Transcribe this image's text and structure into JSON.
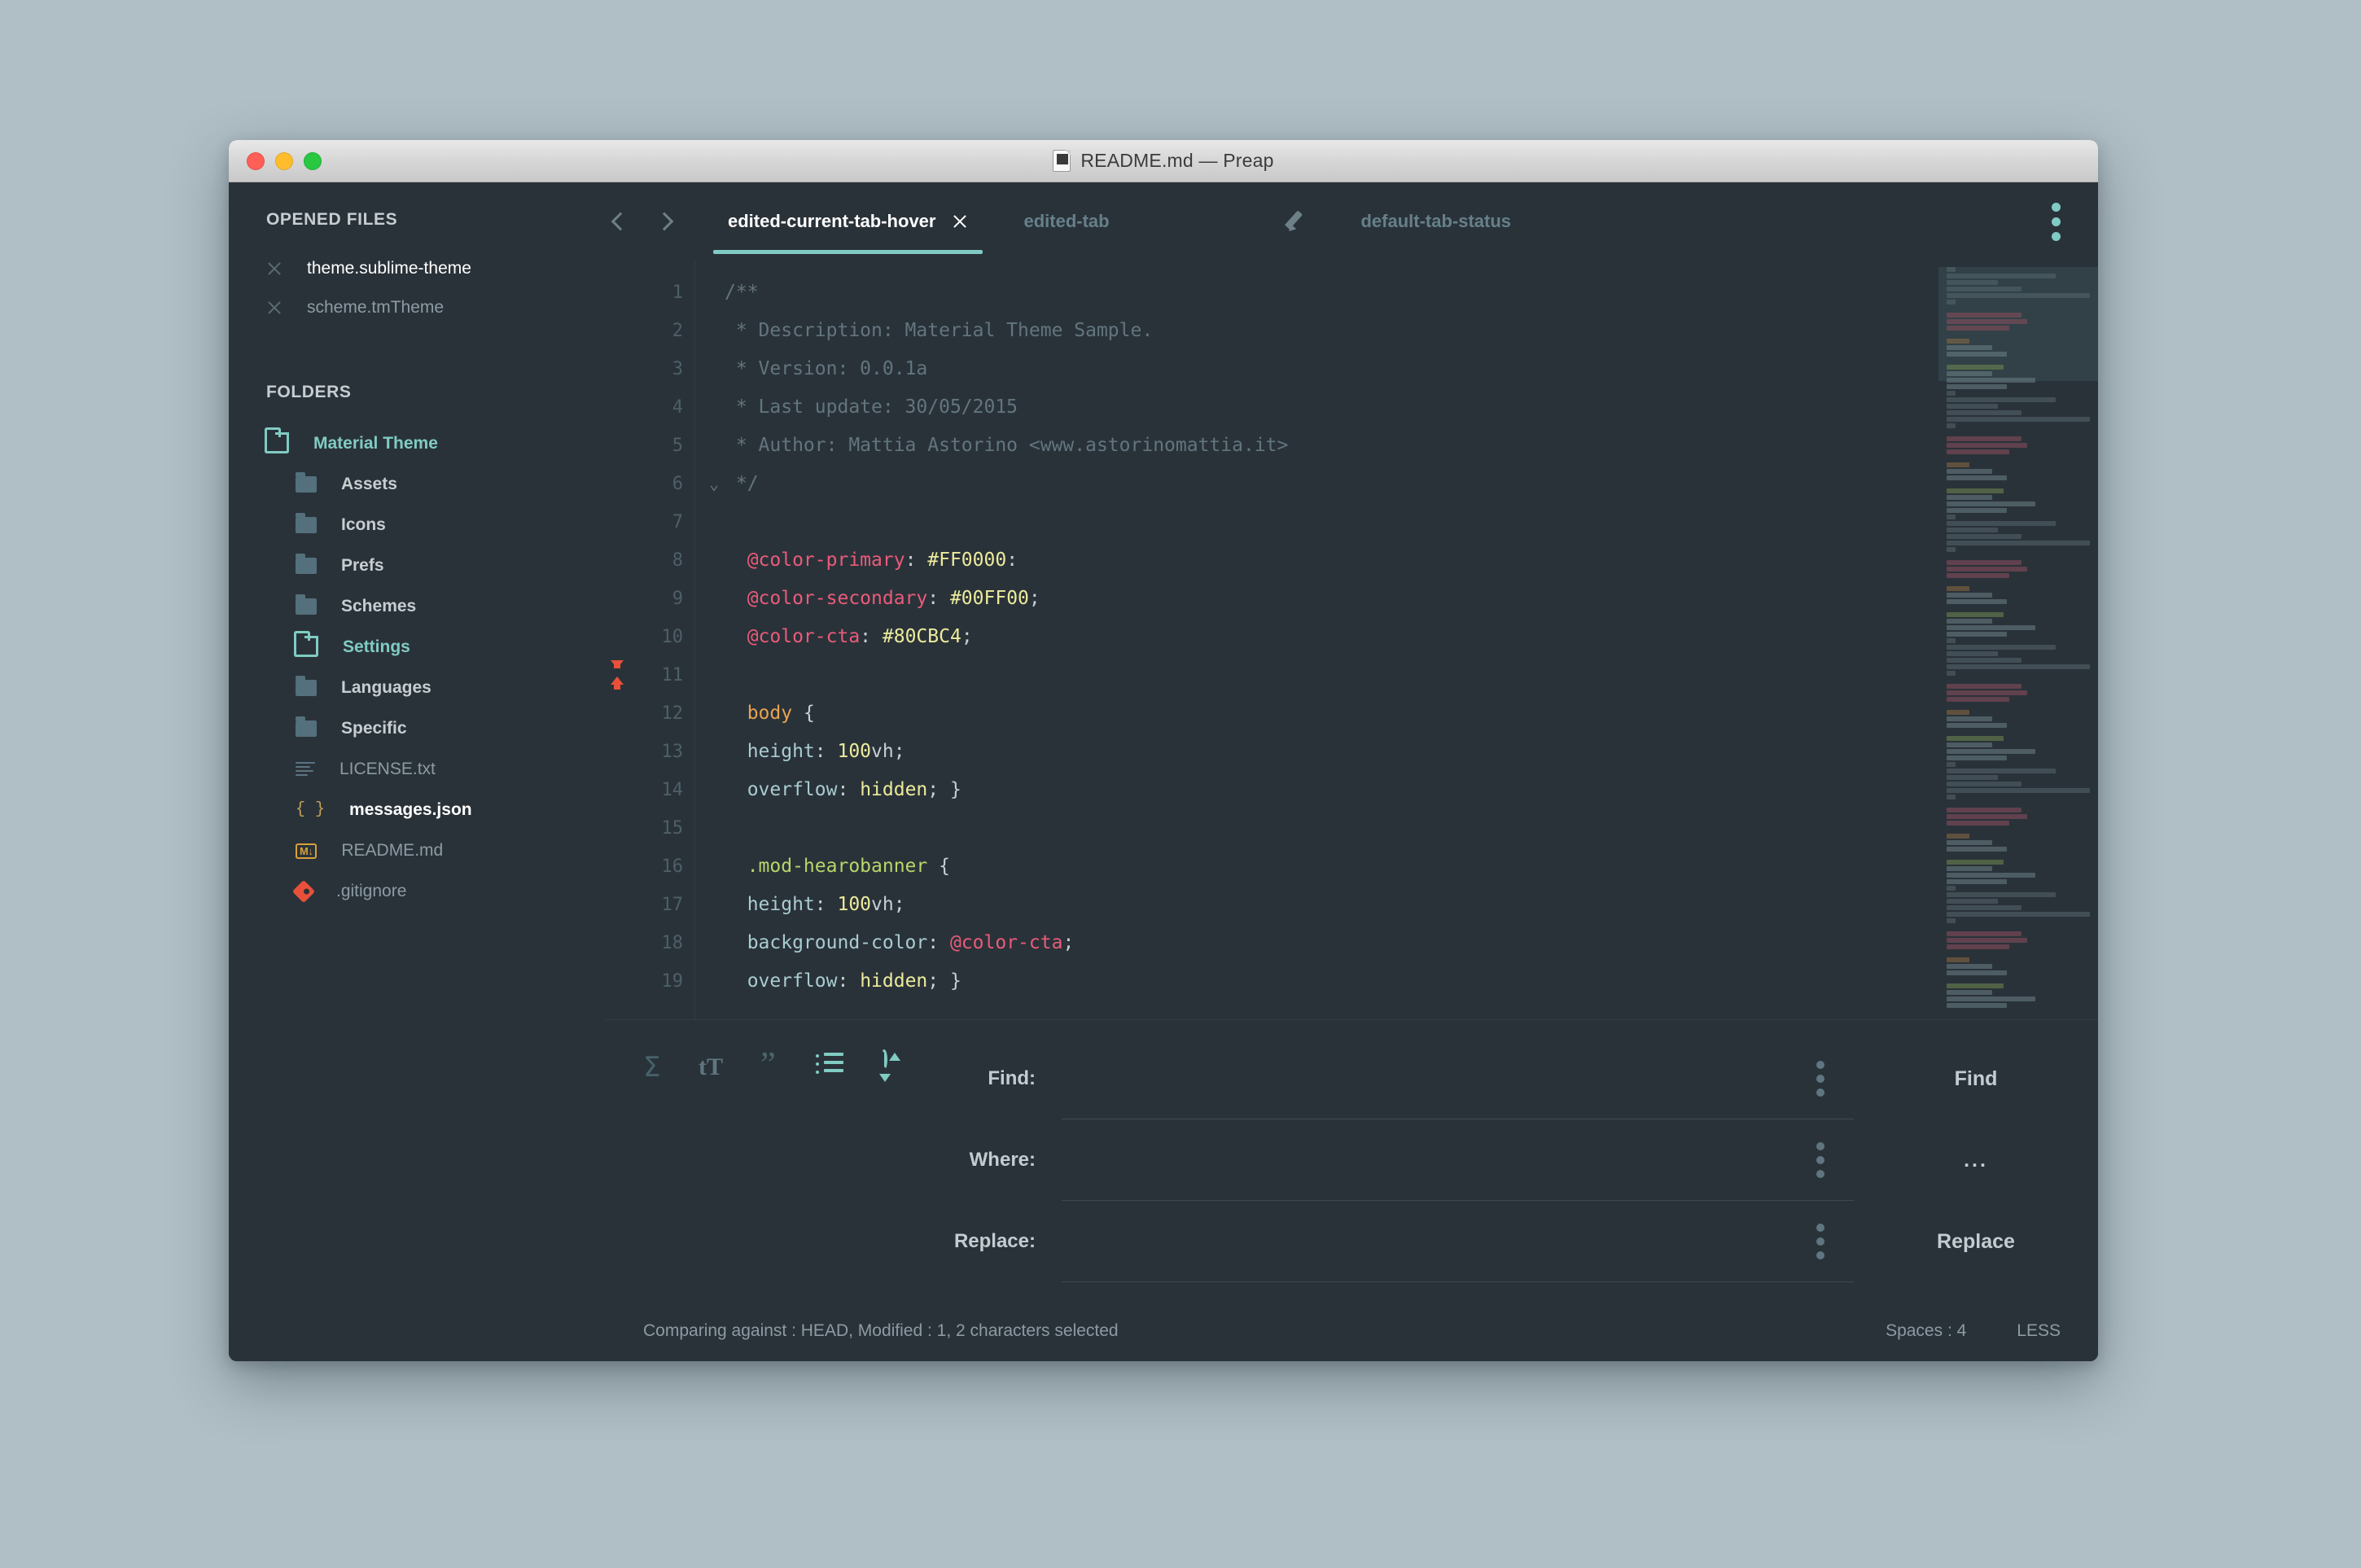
{
  "window": {
    "title": "README.md — Preap",
    "doc_icon": "markdown-file-icon",
    "traffic": {
      "close": "close-button",
      "minimize": "minimize-button",
      "zoom": "zoom-button"
    }
  },
  "sidebar": {
    "opened_files_header": "OPENED FILES",
    "opened_files": [
      {
        "name": "theme.sublime-theme",
        "active": true
      },
      {
        "name": "scheme.tmTheme",
        "active": false
      }
    ],
    "folders_header": "FOLDERS",
    "tree": [
      {
        "label": "Material Theme",
        "icon": "folder-open-icon",
        "kind": "root",
        "depth": 0
      },
      {
        "label": "Assets",
        "icon": "folder-icon",
        "kind": "folder",
        "depth": 1
      },
      {
        "label": "Icons",
        "icon": "folder-icon",
        "kind": "folder",
        "depth": 1
      },
      {
        "label": "Prefs",
        "icon": "folder-icon",
        "kind": "folder",
        "depth": 1
      },
      {
        "label": "Schemes",
        "icon": "folder-icon",
        "kind": "folder",
        "depth": 1
      },
      {
        "label": "Settings",
        "icon": "folder-open-icon",
        "kind": "folder-open",
        "depth": 1
      },
      {
        "label": "Languages",
        "icon": "folder-icon",
        "kind": "folder",
        "depth": 1
      },
      {
        "label": "Specific",
        "icon": "folder-icon",
        "kind": "folder",
        "depth": 1
      },
      {
        "label": "LICENSE.txt",
        "icon": "text-file-icon",
        "kind": "file",
        "depth": 1
      },
      {
        "label": "messages.json",
        "icon": "json-file-icon",
        "kind": "file-active",
        "depth": 1
      },
      {
        "label": "README.md",
        "icon": "markdown-file-icon",
        "kind": "file",
        "depth": 1
      },
      {
        "label": ".gitignore",
        "icon": "git-file-icon",
        "kind": "file",
        "depth": 1
      }
    ]
  },
  "tabs": {
    "prev_icon": "chevron-left-icon",
    "next_icon": "chevron-right-icon",
    "menu_icon": "overflow-menu-icon",
    "items": [
      {
        "label": "edited-current-tab-hover",
        "state": "active",
        "close_icon": "close-icon"
      },
      {
        "label": "edited-tab",
        "state": "edited",
        "close_icon": "pencil-icon"
      },
      {
        "label": "default-tab-status",
        "state": "default",
        "close_icon": ""
      }
    ]
  },
  "editor": {
    "language": "LESS",
    "lines": [
      {
        "n": "1",
        "fold": "",
        "mark": "",
        "tokens": [
          {
            "t": "/**",
            "c": "c-comment"
          }
        ]
      },
      {
        "n": "2",
        "fold": "",
        "mark": "",
        "tokens": [
          {
            "t": " * Description: Material Theme Sample.",
            "c": "c-comment"
          }
        ]
      },
      {
        "n": "3",
        "fold": "",
        "mark": "",
        "tokens": [
          {
            "t": " * Version: 0.0.1a",
            "c": "c-comment"
          }
        ]
      },
      {
        "n": "4",
        "fold": "",
        "mark": "",
        "tokens": [
          {
            "t": " * Last update: 30/05/2015",
            "c": "c-comment"
          }
        ]
      },
      {
        "n": "5",
        "fold": "",
        "mark": "",
        "tokens": [
          {
            "t": " * Author: Mattia Astorino <www.astorinomattia.it>",
            "c": "c-comment"
          }
        ]
      },
      {
        "n": "6",
        "fold": "⌄",
        "mark": "",
        "tokens": [
          {
            "t": " */",
            "c": "c-comment"
          }
        ]
      },
      {
        "n": "7",
        "fold": "",
        "mark": "",
        "tokens": []
      },
      {
        "n": "8",
        "fold": "",
        "mark": "",
        "tokens": [
          {
            "t": "  @color-primary",
            "c": "c-var"
          },
          {
            "t": ": ",
            "c": "c-punct"
          },
          {
            "t": "#FF0000",
            "c": "c-hex"
          },
          {
            "t": ":",
            "c": "c-punct"
          }
        ]
      },
      {
        "n": "9",
        "fold": "",
        "mark": "",
        "tokens": [
          {
            "t": "  @color-secondary",
            "c": "c-var"
          },
          {
            "t": ": ",
            "c": "c-punct"
          },
          {
            "t": "#00FF00",
            "c": "c-hex"
          },
          {
            "t": ";",
            "c": "c-punct"
          }
        ]
      },
      {
        "n": "10",
        "fold": "",
        "mark": "",
        "tokens": [
          {
            "t": "  @color-cta",
            "c": "c-var"
          },
          {
            "t": ": ",
            "c": "c-punct"
          },
          {
            "t": "#80CBC4",
            "c": "c-hex"
          },
          {
            "t": ";",
            "c": "c-punct"
          }
        ]
      },
      {
        "n": "11",
        "fold": "",
        "mark": "diff",
        "tokens": []
      },
      {
        "n": "12",
        "fold": "",
        "mark": "",
        "tokens": [
          {
            "t": "  body",
            "c": "c-tag"
          },
          {
            "t": " {",
            "c": "c-punct"
          }
        ]
      },
      {
        "n": "13",
        "fold": "",
        "mark": "",
        "tokens": [
          {
            "t": "  height",
            "c": "c-prop"
          },
          {
            "t": ": ",
            "c": "c-punct"
          },
          {
            "t": "100",
            "c": "c-num"
          },
          {
            "t": "vh",
            "c": "c-punct"
          },
          {
            "t": ";",
            "c": "c-punct"
          }
        ]
      },
      {
        "n": "14",
        "fold": "",
        "mark": "",
        "tokens": [
          {
            "t": "  overflow",
            "c": "c-prop"
          },
          {
            "t": ": ",
            "c": "c-punct"
          },
          {
            "t": "hidden",
            "c": "c-val"
          },
          {
            "t": "; }",
            "c": "c-punct"
          }
        ]
      },
      {
        "n": "15",
        "fold": "",
        "mark": "",
        "tokens": []
      },
      {
        "n": "16",
        "fold": "",
        "mark": "",
        "tokens": [
          {
            "t": "  .mod-hearobanner",
            "c": "c-sel"
          },
          {
            "t": " {",
            "c": "c-punct"
          }
        ]
      },
      {
        "n": "17",
        "fold": "",
        "mark": "",
        "tokens": [
          {
            "t": "  height",
            "c": "c-prop"
          },
          {
            "t": ": ",
            "c": "c-punct"
          },
          {
            "t": "100",
            "c": "c-num"
          },
          {
            "t": "vh",
            "c": "c-punct"
          },
          {
            "t": ";",
            "c": "c-punct"
          }
        ]
      },
      {
        "n": "18",
        "fold": "",
        "mark": "",
        "tokens": [
          {
            "t": "  background-color",
            "c": "c-prop"
          },
          {
            "t": ": ",
            "c": "c-punct"
          },
          {
            "t": "@color-cta",
            "c": "c-var"
          },
          {
            "t": ";",
            "c": "c-punct"
          }
        ]
      },
      {
        "n": "19",
        "fold": "",
        "mark": "",
        "tokens": [
          {
            "t": "  overflow",
            "c": "c-prop"
          },
          {
            "t": ": ",
            "c": "c-punct"
          },
          {
            "t": "hidden",
            "c": "c-val"
          },
          {
            "t": "; }",
            "c": "c-punct"
          }
        ]
      }
    ]
  },
  "find_panel": {
    "icons": [
      {
        "name": "sigma-icon",
        "glyph": "Σ"
      },
      {
        "name": "font-size-icon",
        "glyph": "tT"
      },
      {
        "name": "quote-icon",
        "glyph": "”"
      },
      {
        "name": "list-icon",
        "glyph": ""
      },
      {
        "name": "refresh-icon",
        "glyph": ""
      }
    ],
    "rows": [
      {
        "label": "Find:",
        "value": "",
        "placeholder": "",
        "menu_icon": "overflow-menu-icon",
        "button": "Find"
      },
      {
        "label": "Where:",
        "value": "",
        "placeholder": "",
        "menu_icon": "overflow-menu-icon",
        "button": "..."
      },
      {
        "label": "Replace:",
        "value": "",
        "placeholder": "",
        "menu_icon": "overflow-menu-icon",
        "button": "Replace"
      }
    ]
  },
  "statusbar": {
    "left": "Comparing against : HEAD, Modified : 1, 2 characters selected",
    "spaces": "Spaces : 4",
    "syntax": "LESS"
  },
  "colors": {
    "accent": "#80cbc4",
    "background": "#2a3239",
    "page_background": "#b0bec5",
    "variable": "#ea5b7a",
    "selector": "#b6d66a",
    "string": "#eceb9c",
    "tag": "#e8a352",
    "property": "#a9ccd1",
    "comment": "#62757e",
    "diff_marker": "#e8503a"
  }
}
